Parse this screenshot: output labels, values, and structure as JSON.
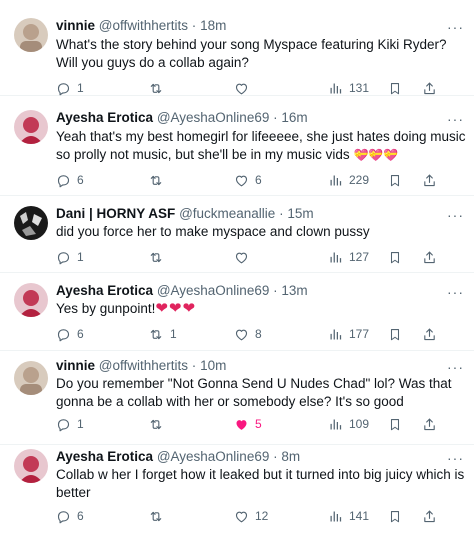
{
  "tweets": [
    {
      "name": "vinnie",
      "handle": "@offwithhertits",
      "sep": "·",
      "time": "18m",
      "more": "···",
      "text": "What's the story behind your song Myspace featuring Kiki Ryder? Will you guys do a collab again?",
      "replies": "1",
      "retweets": "",
      "likes": "",
      "views": "131",
      "liked": false,
      "avatar_color": "#c9b8a8"
    },
    {
      "name": "Ayesha Erotica",
      "handle": "@AyeshaOnline69",
      "sep": "·",
      "time": "16m",
      "more": "···",
      "text": "Yeah that's my best homegirl for lifeeeee, she just hates doing music so prolly not music, but she'll be in my music vids",
      "emoji": "💝💝💝",
      "replies": "6",
      "retweets": "",
      "likes": "6",
      "views": "229",
      "liked": false,
      "avatar_color": "#c23a56"
    },
    {
      "name": "Dani | HORNY ASF",
      "handle": "@fuckmeanallie",
      "sep": "·",
      "time": "15m",
      "more": "···",
      "text": "did you force her to make myspace and clown pussy",
      "replies": "1",
      "retweets": "",
      "likes": "",
      "views": "127",
      "liked": false,
      "avatar_color": "#2a2a2a"
    },
    {
      "name": "Ayesha Erotica",
      "handle": "@AyeshaOnline69",
      "sep": "·",
      "time": "13m",
      "more": "···",
      "text": "Yes by gunpoint!",
      "emoji": "❤❤❤",
      "replies": "6",
      "retweets": "1",
      "likes": "8",
      "views": "177",
      "liked": false,
      "avatar_color": "#c23a56"
    },
    {
      "name": "vinnie",
      "handle": "@offwithhertits",
      "sep": "·",
      "time": "10m",
      "more": "···",
      "text": "Do you remember \"Not Gonna Send U Nudes Chad\" lol? Was that gonna be a collab with her or somebody else? It's so good",
      "replies": "1",
      "retweets": "",
      "likes": "5",
      "views": "109",
      "liked": true,
      "avatar_color": "#c9b8a8"
    },
    {
      "name": "Ayesha Erotica",
      "handle": "@AyeshaOnline69",
      "sep": "·",
      "time": "8m",
      "more": "···",
      "text": "Collab w her I forget how it leaked but it turned into big juicy which is better",
      "replies": "6",
      "retweets": "",
      "likes": "12",
      "views": "141",
      "liked": false,
      "avatar_color": "#c23a56"
    }
  ],
  "colors": {
    "muted": "#536471",
    "like": "#f91880",
    "heart": "#e0245e",
    "text": "#0f1419"
  },
  "icons": {
    "reply": "reply-icon",
    "retweet": "retweet-icon",
    "like": "heart-icon",
    "views": "views-icon",
    "bookmark": "bookmark-icon",
    "share": "share-icon"
  }
}
